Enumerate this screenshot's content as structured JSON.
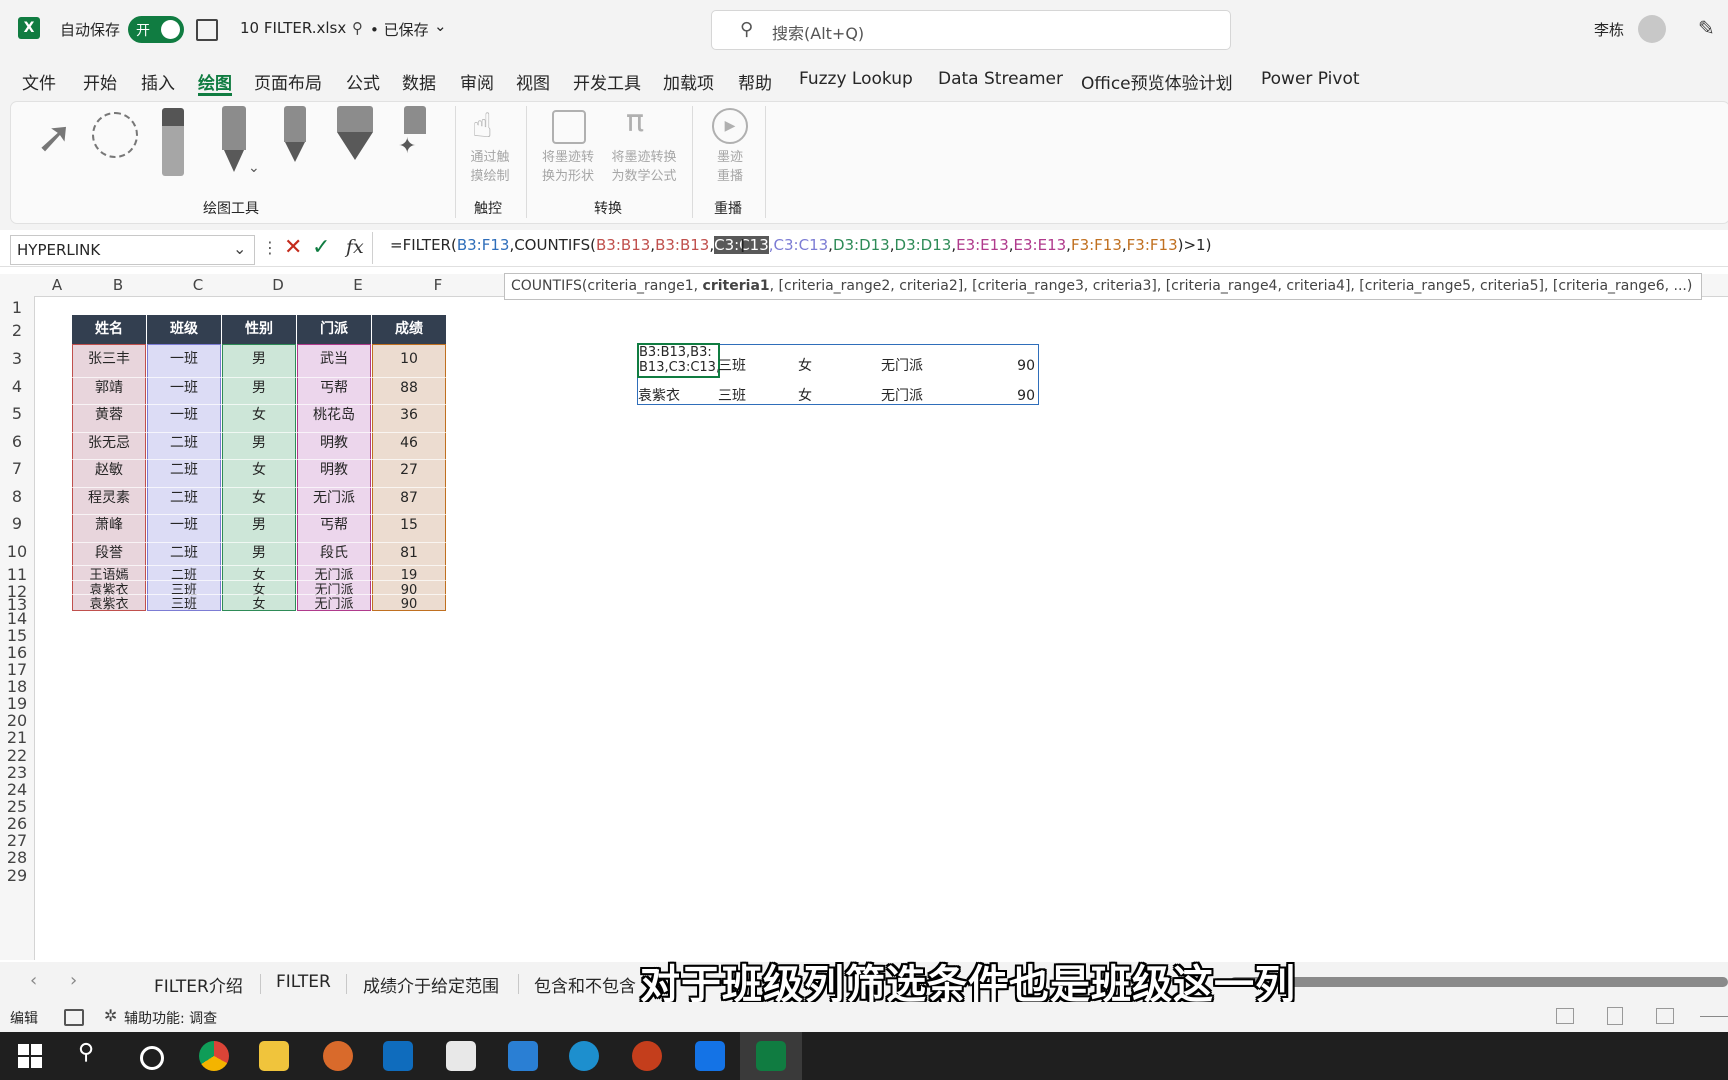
{
  "titlebar": {
    "autosave_label": "自动保存",
    "toggle_label": "开",
    "filename": "10 FILTER.xlsx",
    "saved_status": "• 已保存",
    "search_placeholder": "搜索(Alt+Q)",
    "user_name": "李栋"
  },
  "menu": [
    "文件",
    "开始",
    "插入",
    "绘图",
    "页面布局",
    "公式",
    "数据",
    "审阅",
    "视图",
    "开发工具",
    "加载项",
    "帮助",
    "Fuzzy Lookup",
    "Data Streamer",
    "Office预览体验计划",
    "Power Pivot"
  ],
  "active_menu": "绘图",
  "ribbon": {
    "groups": {
      "drawing_tools": "绘图工具",
      "touch": "触控",
      "convert": "转换",
      "replay": "重播"
    },
    "touch_btn": [
      "通过触",
      "摸绘制"
    ],
    "ink_to_shape": [
      "将墨迹转",
      "换为形状"
    ],
    "ink_to_math": [
      "将墨迹转换",
      "为数学公式"
    ],
    "ink_replay": [
      "墨迹",
      "重播"
    ]
  },
  "formula_bar": {
    "name_box": "HYPERLINK",
    "fx": "fx",
    "formula_parts": [
      {
        "text": "=FILTER(",
        "color": "#262626"
      },
      {
        "text": "B3:F13",
        "color": "#2f6eba"
      },
      {
        "text": ",COUNTIFS(",
        "color": "#262626"
      },
      {
        "text": "B3:B13",
        "color": "#c0504d"
      },
      {
        "text": ",",
        "color": "#262626"
      },
      {
        "text": "B3:B13",
        "color": "#c0504d"
      },
      {
        "text": ",",
        "color": "#262626"
      },
      {
        "text": "C3:C13",
        "color": "#ffffff",
        "highlight": true
      },
      {
        "text": ",C3:C13",
        "color": "#7c7cd4"
      },
      {
        "text": ",",
        "color": "#262626"
      },
      {
        "text": "D3:D13",
        "color": "#2e8b57"
      },
      {
        "text": ",",
        "color": "#262626"
      },
      {
        "text": "D3:D13",
        "color": "#2e8b57"
      },
      {
        "text": ",",
        "color": "#262626"
      },
      {
        "text": "E3:E13",
        "color": "#b03a8c"
      },
      {
        "text": ",",
        "color": "#262626"
      },
      {
        "text": "E3:E13",
        "color": "#b03a8c"
      },
      {
        "text": ",",
        "color": "#262626"
      },
      {
        "text": "F3:F13",
        "color": "#c07020"
      },
      {
        "text": ",",
        "color": "#262626"
      },
      {
        "text": "F3:F13",
        "color": "#c07020"
      },
      {
        "text": ")>1)",
        "color": "#262626"
      }
    ]
  },
  "tooltip": {
    "prefix": "COUNTIFS(criteria_range1, ",
    "bold": "criteria1",
    "suffix": ", [criteria_range2, criteria2], [criteria_range3, criteria3], [criteria_range4, criteria4], [criteria_range5, criteria5], [criteria_range6, ...)"
  },
  "columns": [
    "A",
    "B",
    "C",
    "D",
    "E",
    "F"
  ],
  "rows": [
    "1",
    "2",
    "3",
    "4",
    "5",
    "6",
    "7",
    "8",
    "9",
    "10",
    "11",
    "12",
    "13",
    "14",
    "15",
    "16",
    "17",
    "18",
    "19",
    "20",
    "21",
    "22",
    "23",
    "24",
    "25",
    "26",
    "27",
    "28",
    "29"
  ],
  "table": {
    "headers": [
      "姓名",
      "班级",
      "性别",
      "门派",
      "成绩"
    ],
    "rows": [
      [
        "张三丰",
        "一班",
        "男",
        "武当",
        "10"
      ],
      [
        "郭靖",
        "一班",
        "男",
        "丐帮",
        "88"
      ],
      [
        "黄蓉",
        "一班",
        "女",
        "桃花岛",
        "36"
      ],
      [
        "张无忌",
        "二班",
        "男",
        "明教",
        "46"
      ],
      [
        "赵敏",
        "二班",
        "女",
        "明教",
        "27"
      ],
      [
        "程灵素",
        "二班",
        "女",
        "无门派",
        "87"
      ],
      [
        "萧峰",
        "一班",
        "男",
        "丐帮",
        "15"
      ],
      [
        "段誉",
        "二班",
        "男",
        "段氏",
        "81"
      ],
      [
        "王语嫣",
        "二班",
        "女",
        "无门派",
        "19"
      ],
      [
        "袁紫衣",
        "三班",
        "女",
        "无门派",
        "90"
      ],
      [
        "袁紫衣",
        "三班",
        "女",
        "无门派",
        "90"
      ]
    ]
  },
  "result": {
    "editing_cell": [
      "B3:B13,B3:",
      "B13,C3:C13,"
    ],
    "row1": [
      "三班",
      "女",
      "无门派",
      "90"
    ],
    "row2": [
      "袁紫衣",
      "三班",
      "女",
      "无门派",
      "90"
    ]
  },
  "sheet_tabs": [
    "FILTER介绍",
    "FILTER",
    "成绩介于给定范围",
    "包含和不包含"
  ],
  "subtitle": "对于班级列筛选条件也是班级这一列",
  "status": {
    "mode": "编辑",
    "accessibility": "辅助功能: 调查"
  }
}
